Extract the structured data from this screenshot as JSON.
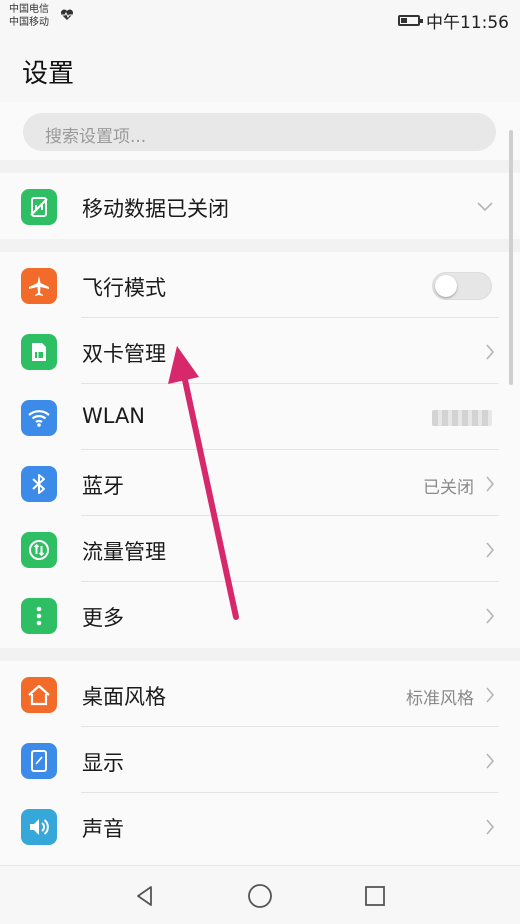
{
  "status_bar": {
    "carrier_1": "中国电信",
    "carrier_2": "中国移动",
    "time": "中午11:56"
  },
  "header": {
    "title": "设置"
  },
  "search": {
    "placeholder": "搜索设置项..."
  },
  "mobile_data": {
    "label": "移动数据已关闭",
    "icon": "mobile-data-off-icon"
  },
  "connectivity": [
    {
      "label": "飞行模式",
      "icon": "airplane-icon",
      "color": "#f26b2a",
      "control": "toggle",
      "toggle_on": false
    },
    {
      "label": "双卡管理",
      "icon": "sim-card-icon",
      "color": "#2ebf64",
      "control": "chevron"
    },
    {
      "label": "WLAN",
      "icon": "wifi-icon",
      "color": "#3d8be8",
      "control": "blurred"
    },
    {
      "label": "蓝牙",
      "icon": "bluetooth-icon",
      "color": "#3d8be8",
      "value": "已关闭",
      "control": "chevron"
    },
    {
      "label": "流量管理",
      "icon": "data-usage-icon",
      "color": "#2ebf64",
      "control": "chevron"
    },
    {
      "label": "更多",
      "icon": "more-icon",
      "color": "#2ebf64",
      "control": "chevron"
    }
  ],
  "display": [
    {
      "label": "桌面风格",
      "icon": "home-icon",
      "color": "#f26b2a",
      "value": "标准风格",
      "control": "chevron"
    },
    {
      "label": "显示",
      "icon": "display-icon",
      "color": "#3d8be8",
      "control": "chevron"
    },
    {
      "label": "声音",
      "icon": "sound-icon",
      "color": "#35a7d8",
      "control": "chevron"
    }
  ],
  "navbar": {
    "back_icon": "back-icon",
    "home_icon": "home-circle-icon",
    "recents_icon": "recents-icon"
  },
  "annotation": {
    "arrow_color": "#d8286c"
  }
}
